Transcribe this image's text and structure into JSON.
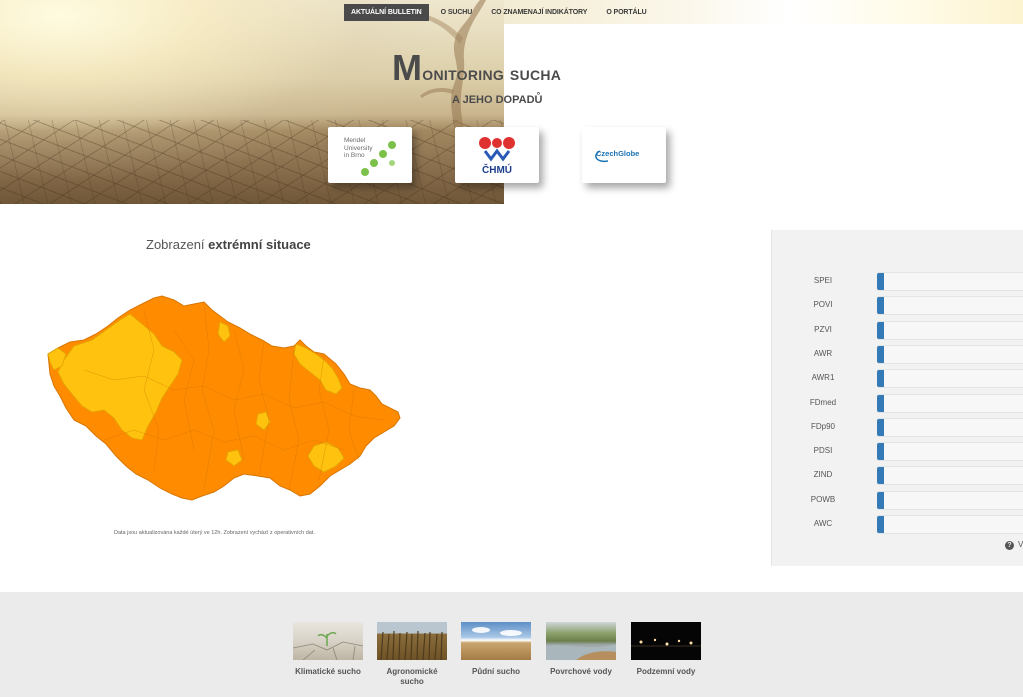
{
  "nav": {
    "items": [
      {
        "label": "Aktuální bulletin",
        "active": true
      },
      {
        "label": "O suchu",
        "active": false
      },
      {
        "label": "Co znamenají indikátory",
        "active": false
      },
      {
        "label": "O portálu",
        "active": false
      }
    ]
  },
  "header": {
    "title_first": "M",
    "title_rest": "onitoring sucha",
    "subtitle": "a jeho dopadů"
  },
  "partners": {
    "mendel": "Mendel\nUniversity\nin Brno",
    "chmu": "ČHMÚ",
    "czechglobe": "CzechGlobe"
  },
  "map": {
    "heading_plain": "Zobrazení",
    "heading_bold": "extrémní situace",
    "note": "Data jsou aktualizována každé úterý ve 12h. Zobrazení vychází z operativních dat.",
    "colors": {
      "extreme": "#ff8c00",
      "severe": "#ffc20e",
      "border": "#d87500"
    }
  },
  "indicators": {
    "rows": [
      {
        "label": "SPEI",
        "level": 0.04
      },
      {
        "label": "POVI",
        "level": 0.04
      },
      {
        "label": "PZVI",
        "level": 0.04
      },
      {
        "label": "AWR",
        "level": 0.04
      },
      {
        "label": "AWR1",
        "level": 0.04
      },
      {
        "label": "FDmed",
        "level": 0.04
      },
      {
        "label": "FDp90",
        "level": 0.04
      },
      {
        "label": "PDSI",
        "level": 0.04
      },
      {
        "label": "ZIND",
        "level": 0.04
      },
      {
        "label": "POWB",
        "level": 0.04
      },
      {
        "label": "AWC",
        "level": 0.04
      }
    ],
    "help_text": "V",
    "bar_color": "#337ab7"
  },
  "footer": {
    "tiles": [
      {
        "label": "Klimatické sucho"
      },
      {
        "label": "Agronomické sucho"
      },
      {
        "label": "Půdní sucho"
      },
      {
        "label": "Povrchové vody"
      },
      {
        "label": "Podzemní vody"
      }
    ]
  }
}
